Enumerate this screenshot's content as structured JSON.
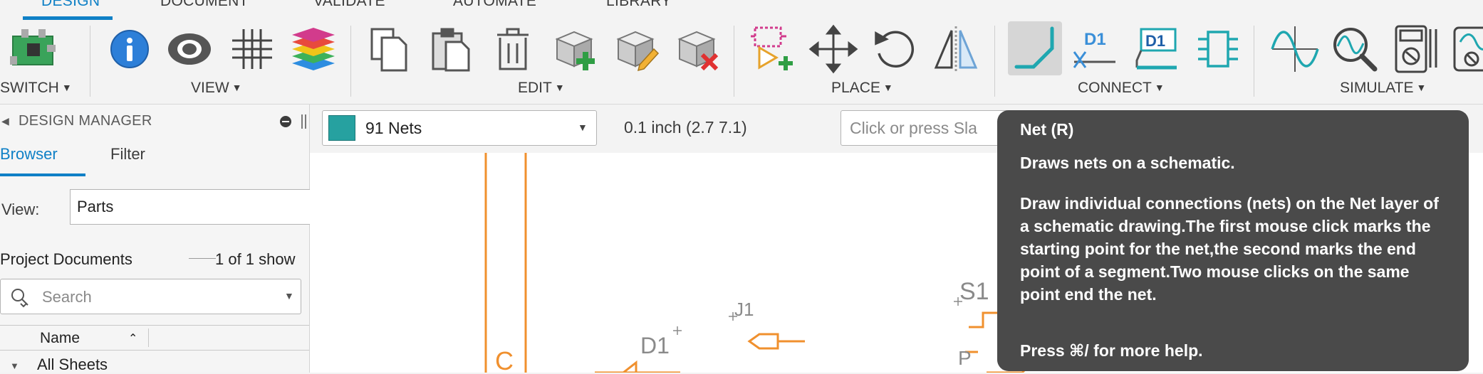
{
  "tabs": [
    "DESIGN",
    "DOCUMENT",
    "VALIDATE",
    "AUTOMATE",
    "LIBRARY"
  ],
  "toolbar": {
    "groups": [
      "SWITCH",
      "VIEW",
      "EDIT",
      "PLACE",
      "CONNECT",
      "SIMULATE"
    ],
    "icons": {
      "switch": "pcb-board-icon",
      "view": [
        "info-icon",
        "eye-icon",
        "grid-icon",
        "layers-icon"
      ],
      "edit": [
        "copy-icon",
        "paste-icon",
        "delete-icon",
        "add-part-icon",
        "edit-part-icon",
        "remove-part-icon"
      ],
      "place": [
        "add-component-icon",
        "move-icon",
        "rotate-icon",
        "mirror-icon"
      ],
      "connect": [
        "net-icon",
        "name-icon",
        "label-icon",
        "bus-icon"
      ],
      "simulate": [
        "waveform-icon",
        "probe-icon",
        "multimeter-icon",
        "oscilloscope-icon"
      ]
    },
    "connect_labels": [
      "D1",
      "D1"
    ]
  },
  "design_manager": {
    "title": "DESIGN MANAGER",
    "tabs": [
      "Browser",
      "Filter"
    ],
    "view_label": "View:",
    "view_value": "Parts",
    "project_label": "Project Documents",
    "project_count": "1 of 1 show",
    "search_placeholder": "Search",
    "column_name": "Name",
    "tree_root": "All Sheets"
  },
  "command_bar": {
    "layer": "91 Nets",
    "layer_color": "#26a1a0",
    "grid_readout": "0.1 inch (2.7 7.1)",
    "command_placeholder": "Click or press Sla"
  },
  "canvas": {
    "labels": {
      "d1": "D1",
      "j1": "J1",
      "s1": "S1",
      "p": "P",
      "c": "C"
    },
    "wire_color": "#f0902e"
  },
  "tooltip": {
    "title": "Net (R)",
    "subtitle": "Draws nets on a schematic.",
    "body": "Draw individual connections (nets) on the Net layer of a schematic drawing.The first mouse click marks the starting point for the net,the second marks the end point of a segment.Two mouse clicks on the same point end the net.",
    "footer": "Press ⌘/ for more help."
  },
  "colors": {
    "accent": "#0f80c6",
    "teal": "#26a1a0",
    "wire": "#f0902e"
  }
}
